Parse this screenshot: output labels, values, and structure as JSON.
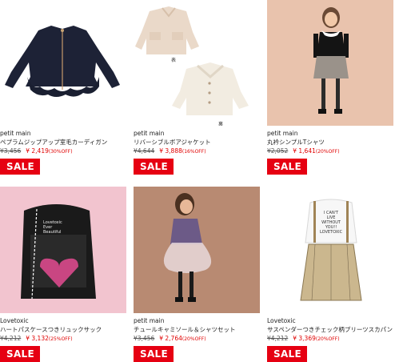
{
  "products": [
    {
      "brand": "petit main",
      "name": "ペプラムジップアップ室毛カーディガン",
      "old_price": "¥3,456",
      "new_price": "¥ 2,419",
      "discount": "(30%OFF)",
      "sale": "SALE"
    },
    {
      "brand": "petit main",
      "name": "リバーシブルボアジャケット",
      "old_price": "¥4,644",
      "new_price": "¥ 3,888",
      "discount": "(16%OFF)",
      "sale": "SALE",
      "captions": [
        "表",
        "裏"
      ]
    },
    {
      "brand": "petit main",
      "name": "丸衿シンプルTシャツ",
      "old_price": "¥2,052",
      "new_price": "¥ 1,641",
      "discount": "(20%OFF)",
      "sale": "SALE"
    },
    {
      "brand": "Lovetoxic",
      "name": "ハートパスケースつきリュックサック",
      "old_price": "¥4,212",
      "new_price": "¥ 3,132",
      "discount": "(25%OFF)",
      "sale": "SALE",
      "bag_text": [
        "Lovetoxic",
        "Ever",
        "Beautiful"
      ]
    },
    {
      "brand": "petit main",
      "name": "チュールキャミソール＆シャツセット",
      "old_price": "¥3,456",
      "new_price": "¥ 2,764",
      "discount": "(20%OFF)",
      "sale": "SALE"
    },
    {
      "brand": "Lovetoxic",
      "name": "サスペンダーつきチェック柄プリーツスカパン",
      "old_price": "¥4,212",
      "new_price": "¥ 3,369",
      "discount": "(20%OFF)",
      "sale": "SALE",
      "shirt_text": [
        "I CAN'T",
        "LIVE",
        "WITHOUT",
        "YOU!!",
        "LOVETOXIC"
      ]
    }
  ]
}
